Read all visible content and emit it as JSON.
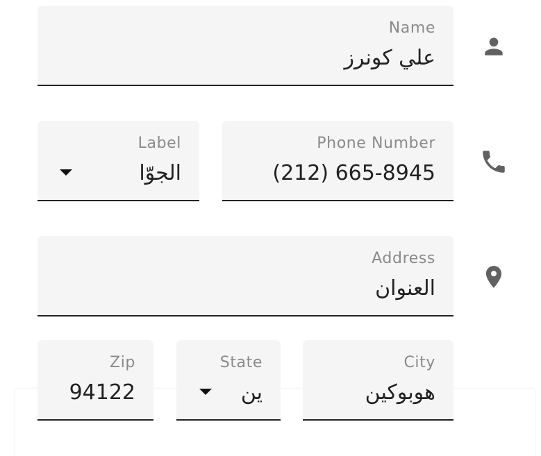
{
  "form": {
    "name": {
      "label": "Name",
      "value": "علي كونرز",
      "icon": "person-icon"
    },
    "phone": {
      "label": "Phone Number",
      "value": "(212) 665-8945",
      "icon": "phone-icon"
    },
    "phone_type": {
      "label": "Label",
      "value": "الجوّا"
    },
    "address": {
      "label": "Address",
      "value": "العنوان",
      "icon": "location-pin-icon"
    },
    "city": {
      "label": "City",
      "value": "هوبوكين"
    },
    "state": {
      "label": "State",
      "value": "ين"
    },
    "zip": {
      "label": "Zip",
      "value": "94122"
    }
  },
  "colors": {
    "field_background": "#f5f5f5",
    "underline": "#222222",
    "label_text": "#8a8a8a",
    "value_text": "#212121",
    "icon": "#616161"
  }
}
